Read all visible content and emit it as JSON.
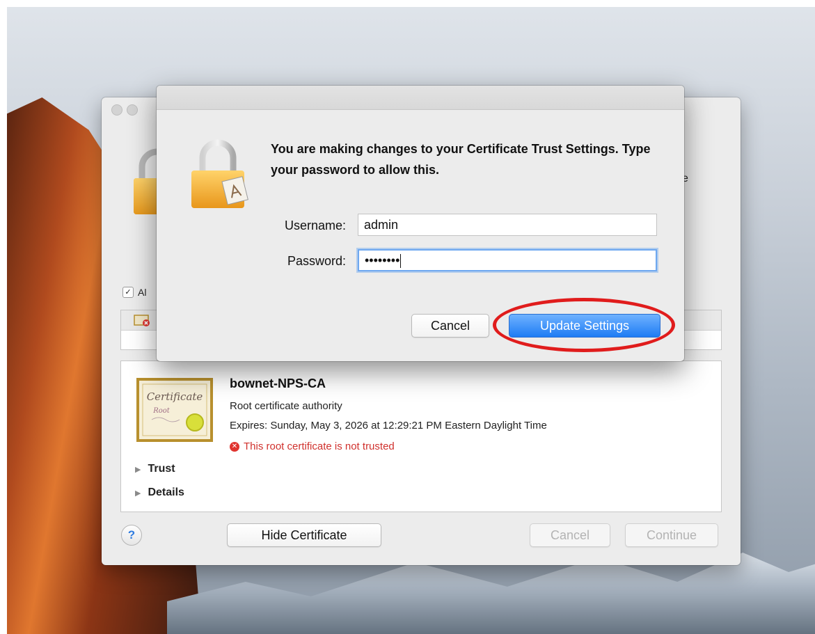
{
  "dialog": {
    "message": "You are making changes to your Certificate Trust Settings. Type your password to allow this.",
    "username_label": "Username:",
    "username_value": "admin",
    "password_label": "Password:",
    "password_value": "••••••••",
    "cancel_label": "Cancel",
    "update_label": "Update Settings"
  },
  "background_window": {
    "partial_text": "e",
    "always_trust_partial": "Al",
    "always_trust_checked": true,
    "certificate": {
      "name": "bownet-NPS-CA",
      "type": "Root certificate authority",
      "expires": "Expires: Sunday, May 3, 2026 at 12:29:21 PM Eastern Daylight Time",
      "status": "This root certificate is not trusted",
      "image_title": "Certificate",
      "image_subtitle": "Root"
    },
    "disclosures": [
      "Trust",
      "Details"
    ],
    "help_label": "?",
    "hide_certificate_label": "Hide Certificate",
    "cancel_label": "Cancel",
    "continue_label": "Continue"
  },
  "colors": {
    "accent": "#1e7cf4",
    "error": "#d0312d",
    "annotation_ring": "#e01c1c"
  }
}
